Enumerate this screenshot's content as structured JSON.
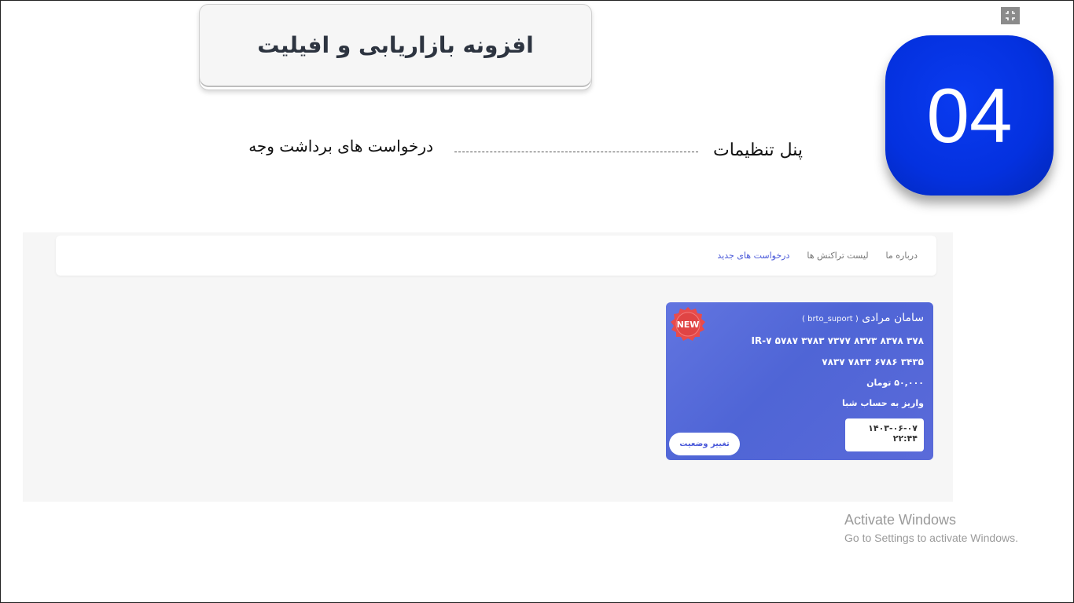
{
  "header": {
    "title": "افزونه بازاریابی و افیلیت",
    "step_number": "04",
    "fullscreen_icon": "exit-fullscreen-icon"
  },
  "annotation": {
    "panel_label": "پنل تنظیمات",
    "request_label": "درخواست های برداشت وجه"
  },
  "app": {
    "nav": {
      "items": [
        {
          "label": "درخواست های جدید",
          "active": true
        },
        {
          "label": "لیست تراکنش ها",
          "active": false
        },
        {
          "label": "درباره ما",
          "active": false
        }
      ]
    },
    "card": {
      "name": "سامان مرادی",
      "handle": "( brto_suport )",
      "account_line1": "IR-۷ ۵۷۸۷ ۳۷۸۳ ۷۳۷۷ ۸۳۷۳ ۸۳۷۸ ۳۷۸",
      "account_line2": "۳۴۳۵ ۶۷۸۶ ۷۸۳۳ ۷۸۳۷",
      "amount": "۵۰,۰۰۰ تومان",
      "method": "واریز به حساب شبا",
      "date": "۱۴۰۳-۰۶-۰۷",
      "time": "۲۲:۴۴",
      "status_button": "تغییر وضعیت",
      "badge": "NEW",
      "badge_color": "#e84b4b"
    }
  },
  "watermark": {
    "title": "Activate Windows",
    "subtitle": "Go to Settings to activate Windows."
  },
  "colors": {
    "badge_blue": "#0431df",
    "card_blue": "#5568d9",
    "nav_active": "#4a59d9"
  }
}
